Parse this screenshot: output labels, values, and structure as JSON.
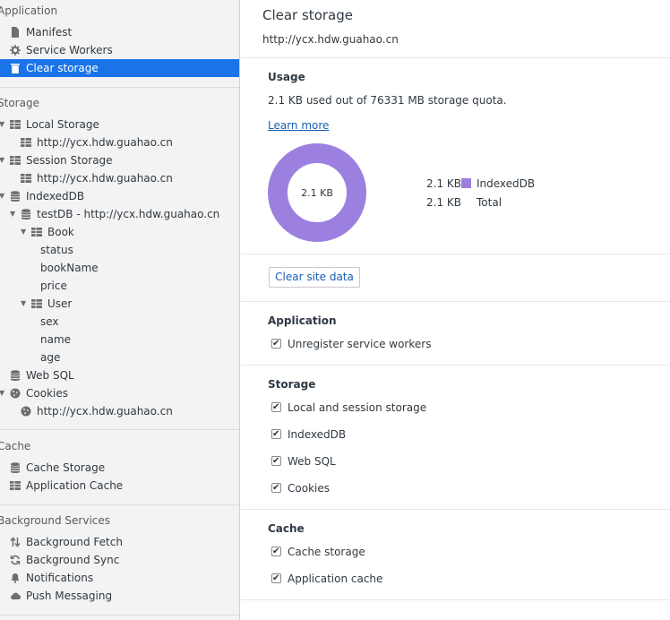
{
  "sidebar": {
    "application": {
      "title": "Application",
      "items": [
        {
          "label": "Manifest"
        },
        {
          "label": "Service Workers"
        },
        {
          "label": "Clear storage"
        }
      ]
    },
    "storage": {
      "title": "Storage",
      "local_storage": {
        "label": "Local Storage",
        "child": "http://ycx.hdw.guahao.cn"
      },
      "session_storage": {
        "label": "Session Storage",
        "child": "http://ycx.hdw.guahao.cn"
      },
      "indexeddb": {
        "label": "IndexedDB",
        "db": "testDB - http://ycx.hdw.guahao.cn",
        "stores": [
          {
            "label": "Book",
            "fields": [
              "status",
              "bookName",
              "price"
            ]
          },
          {
            "label": "User",
            "fields": [
              "sex",
              "name",
              "age"
            ]
          }
        ]
      },
      "web_sql": {
        "label": "Web SQL"
      },
      "cookies": {
        "label": "Cookies",
        "child": "http://ycx.hdw.guahao.cn"
      }
    },
    "cache": {
      "title": "Cache",
      "items": [
        {
          "label": "Cache Storage"
        },
        {
          "label": "Application Cache"
        }
      ]
    },
    "background": {
      "title": "Background Services",
      "items": [
        {
          "label": "Background Fetch"
        },
        {
          "label": "Background Sync"
        },
        {
          "label": "Notifications"
        },
        {
          "label": "Push Messaging"
        }
      ]
    }
  },
  "main": {
    "title": "Clear storage",
    "origin": "http://ycx.hdw.guahao.cn",
    "usage": {
      "heading": "Usage",
      "summary": "2.1 KB used out of 76331 MB storage quota.",
      "learn_more": "Learn more",
      "donut_label": "2.1 KB",
      "legend": [
        {
          "size": "2.1 KB",
          "name": "IndexedDB",
          "color": "#9b80e0"
        },
        {
          "size": "2.1 KB",
          "name": "Total"
        }
      ]
    },
    "clear_button": "Clear site data",
    "application": {
      "heading": "Application",
      "options": [
        {
          "label": "Unregister service workers",
          "checked": true
        }
      ]
    },
    "storage": {
      "heading": "Storage",
      "options": [
        {
          "label": "Local and session storage",
          "checked": true
        },
        {
          "label": "IndexedDB",
          "checked": true
        },
        {
          "label": "Web SQL",
          "checked": true
        },
        {
          "label": "Cookies",
          "checked": true
        }
      ]
    },
    "cache": {
      "heading": "Cache",
      "options": [
        {
          "label": "Cache storage",
          "checked": true
        },
        {
          "label": "Application cache",
          "checked": true
        }
      ]
    }
  },
  "colors": {
    "selection": "#1a73e8",
    "donut": "#9b80e0",
    "link": "#1a5fb4"
  }
}
